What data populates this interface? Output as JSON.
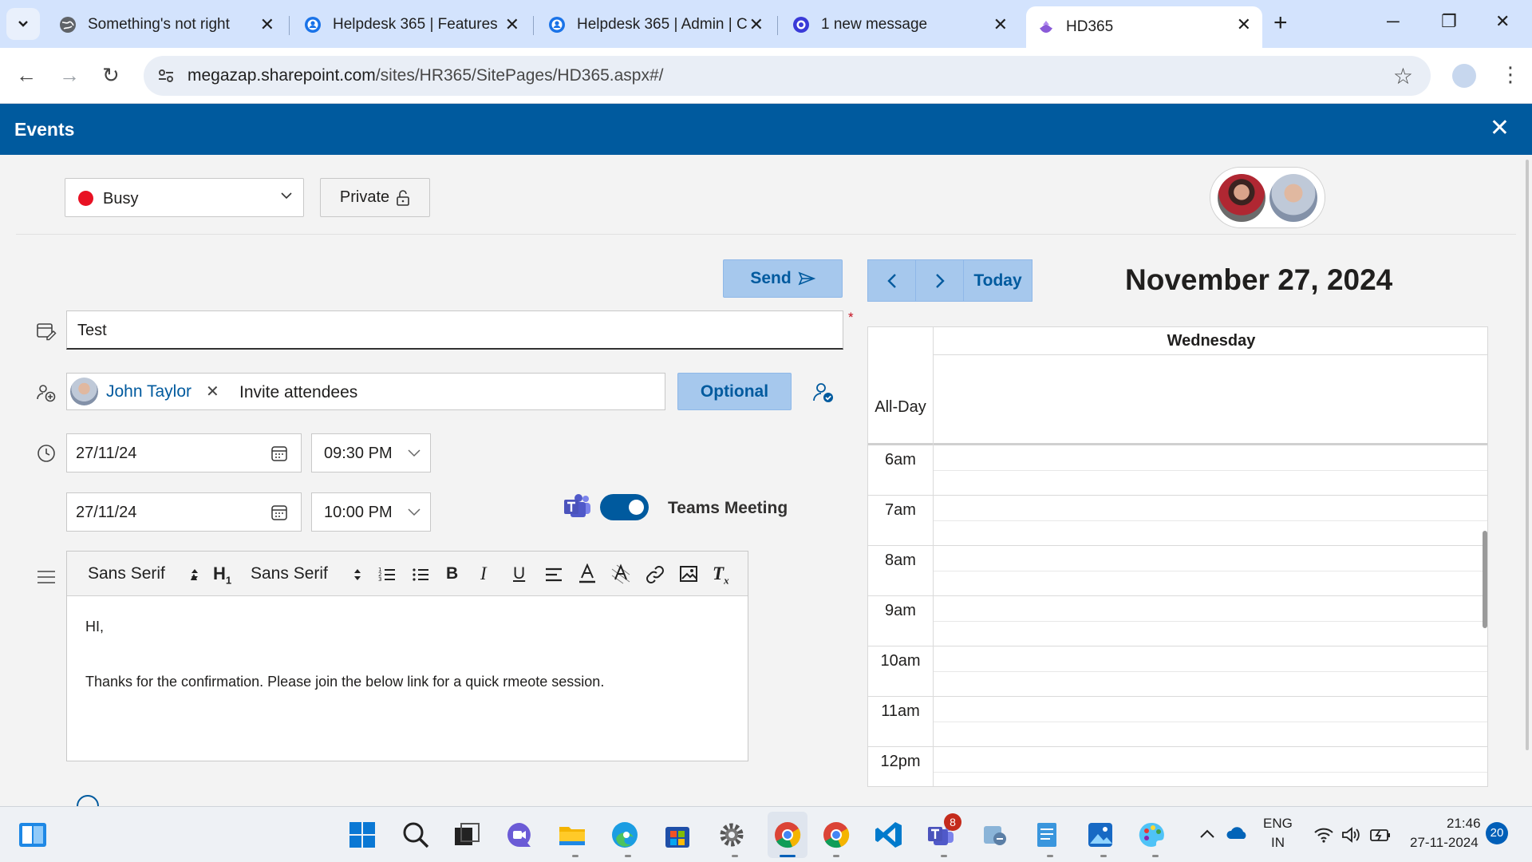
{
  "browser": {
    "tabs": [
      {
        "title": "Something's not right",
        "icon": "error-globe-icon"
      },
      {
        "title": "Helpdesk 365 | Features",
        "icon": "helpdesk-icon"
      },
      {
        "title": "Helpdesk 365 | Admin | C",
        "icon": "helpdesk-icon"
      },
      {
        "title": "1 new message",
        "icon": "message-icon"
      },
      {
        "title": "HD365",
        "icon": "hd365-icon"
      }
    ],
    "url_host": "megazap.sharepoint.com",
    "url_path": "/sites/HR365/SitePages/HD365.aspx#/"
  },
  "panel": {
    "title": "Events"
  },
  "form": {
    "status": "Busy",
    "status_color": "#e81123",
    "private_label": "Private",
    "send_label": "Send",
    "subject_value": "Test",
    "required_marker": "*",
    "attendee_name": "John Taylor",
    "invite_placeholder": "Invite attendees",
    "optional_label": "Optional",
    "start_date": "27/11/24",
    "start_time": "09:30 PM",
    "end_date": "27/11/24",
    "end_time": "10:00 PM",
    "teams_label": "Teams Meeting",
    "teams_enabled": true,
    "accent_color": "#005a9e"
  },
  "editor": {
    "font1": "Sans Serif",
    "heading": "H",
    "heading_sub": "1",
    "font2": "Sans Serif",
    "bold": "B",
    "italic": "I",
    "underline": "U",
    "clear": "T",
    "clear_sub": "x",
    "body_line1": "HI,",
    "body_line2": "Thanks for the confirmation. Please join the below link for a quick rmeote session."
  },
  "calendar": {
    "today_label": "Today",
    "date_title": "November 27, 2024",
    "day_header": "Wednesday",
    "allday_label": "All-Day",
    "hours": [
      "6am",
      "7am",
      "8am",
      "9am",
      "10am",
      "11am",
      "12pm"
    ]
  },
  "taskbar": {
    "lang1": "ENG",
    "lang2": "IN",
    "time": "21:46",
    "date": "27-11-2024",
    "notifications": "20",
    "teams_badge": "8"
  }
}
